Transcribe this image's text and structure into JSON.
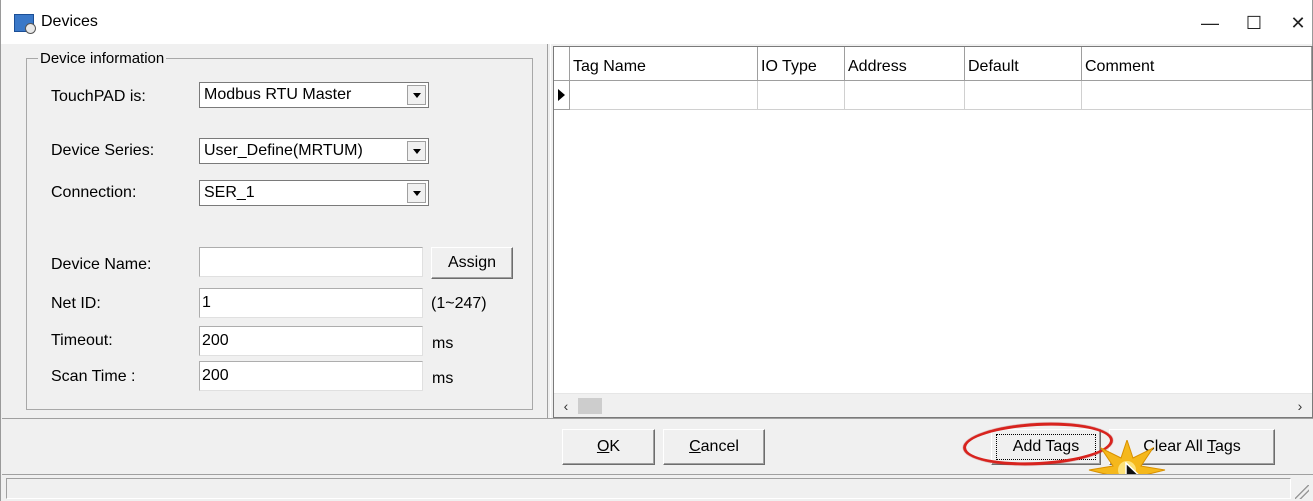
{
  "window": {
    "title": "Devices",
    "minimize_glyph": "—",
    "maximize_glyph": "☐",
    "close_glyph": "✕"
  },
  "device_info": {
    "group_title": "Device information",
    "touchpad_label": "TouchPAD is:",
    "touchpad_value": "Modbus RTU Master",
    "series_label": "Device Series:",
    "series_value": "User_Define(MRTUM)",
    "connection_label": "Connection:",
    "connection_value": "SER_1",
    "name_label": "Device Name:",
    "name_value": "",
    "assign_label": "Assign",
    "netid_label": "Net ID:",
    "netid_value": "1",
    "netid_range": "(1~247)",
    "timeout_label": "Timeout:",
    "timeout_value": "200",
    "timeout_unit": "ms",
    "scan_label": "Scan Time :",
    "scan_value": "200",
    "scan_unit": "ms"
  },
  "tag_grid": {
    "columns": [
      "Tag Name",
      "IO Type",
      "Address",
      "Default",
      "Comment"
    ],
    "rows": [
      [
        "",
        "",
        "",
        "",
        ""
      ]
    ],
    "scroll_left": "‹",
    "scroll_right": "›"
  },
  "buttons": {
    "ok_prefix": "",
    "ok_key": "O",
    "ok_rest": "K",
    "cancel_key": "C",
    "cancel_rest": "ancel",
    "add_tags": "Add Tags",
    "clear_pre": "Clear All ",
    "clear_key": "T",
    "clear_rest": "ags"
  },
  "colors": {
    "highlight": "#d8231e",
    "starburst": "#f5b81c"
  },
  "icons": {
    "app": "devices-app-icon",
    "cursor": "mouse-pointer-icon",
    "click": "click-starburst-icon"
  }
}
